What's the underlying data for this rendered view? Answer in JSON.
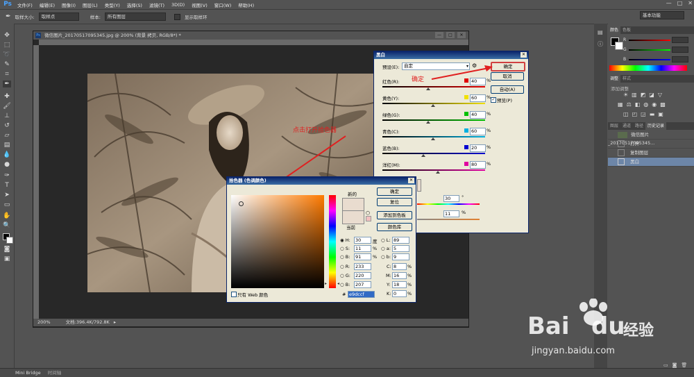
{
  "app": {
    "logo": "Ps"
  },
  "menu": [
    "文件(F)",
    "编辑(E)",
    "图像(I)",
    "图层(L)",
    "类型(Y)",
    "选择(S)",
    "滤镜(T)",
    "3D(D)",
    "视图(V)",
    "窗口(W)",
    "帮助(H)"
  ],
  "window_controls": [
    "—",
    "□",
    "✕"
  ],
  "options": {
    "sample_size_label": "取样大小:",
    "sample_size_value": "取样点",
    "sample_label": "样本:",
    "sample_value": "所有图层",
    "show_ring": "显示取样环",
    "workspace": "基本功能"
  },
  "document": {
    "title": "微信图片_20170517095345.jpg @ 200% (背景 拷贝, RGB/8*) *",
    "zoom": "200%",
    "doc_info": "文档:396.4K/792.8K"
  },
  "bottom_tabs": [
    "Mini Bridge",
    "时间轴"
  ],
  "bw_dialog": {
    "title": "黑白",
    "preset_label": "预设(E):",
    "preset_value": "自定",
    "ok": "确定",
    "cancel": "取消",
    "auto": "自动(A)",
    "preview": "预览(P)",
    "rows": [
      {
        "label": "红色(R):",
        "value": "40",
        "swatch": "#e00000"
      },
      {
        "label": "黄色(Y):",
        "value": "60",
        "swatch": "#f0e000"
      },
      {
        "label": "绿色(G):",
        "value": "40",
        "swatch": "#00c000"
      },
      {
        "label": "青色(C):",
        "value": "60",
        "swatch": "#00b0e0"
      },
      {
        "label": "蓝色(B):",
        "value": "20",
        "swatch": "#0000d0"
      },
      {
        "label": "洋红(M):",
        "value": "80",
        "swatch": "#e000a0"
      }
    ],
    "pct": "%",
    "tint_hue": "30",
    "tint_hue_unit": "°",
    "tint_sat": "11",
    "tint_sat_unit": "%"
  },
  "color_picker": {
    "title": "拾色器 (色调颜色)",
    "ok": "确定",
    "reset": "复位",
    "add_swatch": "添加到色板",
    "libraries": "颜色库",
    "new_label": "新的",
    "current_label": "当前",
    "web_only": "只有 Web 颜色",
    "new_color": "#e9dccf",
    "fields": {
      "H": "30",
      "H_unit": "度",
      "S": "11",
      "S_unit": "%",
      "B": "91",
      "B_unit": "%",
      "R": "233",
      "G": "220",
      "Bv": "207",
      "L": "89",
      "a": "5",
      "b": "9",
      "C": "8",
      "M": "16",
      "Y": "18",
      "K": "0",
      "cmyk_unit": "%"
    },
    "hex_label": "#",
    "hex": "e9dccf"
  },
  "annotations": {
    "click_color": "点击打开拾色器",
    "confirm": "确定"
  },
  "panels": {
    "color_tabs": [
      "颜色",
      "色板"
    ],
    "adjust_tabs": [
      "调整",
      "样式"
    ],
    "adjust_add": "添加调整",
    "layers_tabs": [
      "图层",
      "通道",
      "路径",
      "历史记录"
    ],
    "history": [
      {
        "label": "微信图片_20170517095345...",
        "active": false
      },
      {
        "label": "打开",
        "active": false
      },
      {
        "label": "复制图层",
        "active": false
      },
      {
        "label": "黑白",
        "active": true
      }
    ],
    "rgb_labels": [
      "R",
      "G",
      "B"
    ]
  },
  "watermark": {
    "brand": "Bai",
    "brand2": "du",
    "cn": "经验",
    "url": "jingyan.baidu.com"
  }
}
